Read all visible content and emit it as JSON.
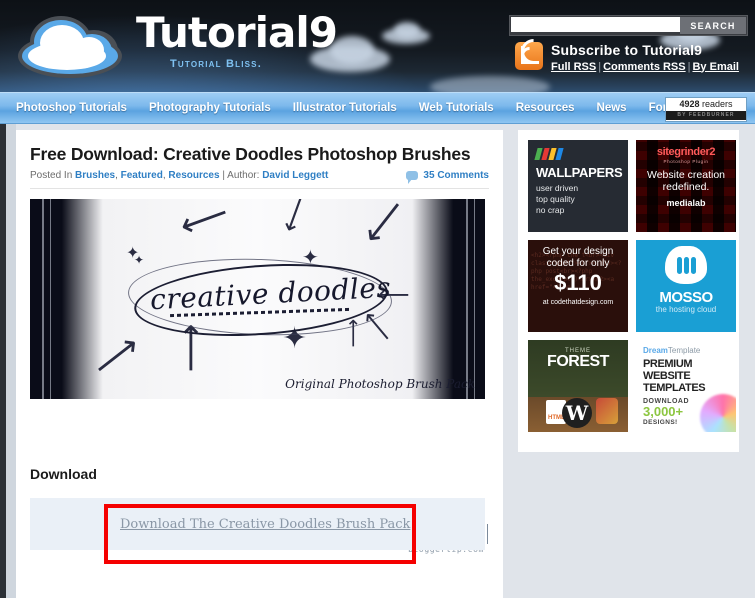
{
  "header": {
    "logo_text": "Tutorial9",
    "logo_tagline": "Tutorial Bliss.",
    "search": {
      "value": "",
      "placeholder": "",
      "button_label": "SEARCH"
    },
    "rss": {
      "title": "Subscribe to Tutorial9",
      "links": [
        "Full RSS",
        "Comments RSS",
        "By Email"
      ],
      "separator": "|"
    }
  },
  "nav": {
    "items": [
      "Photoshop Tutorials",
      "Photography Tutorials",
      "Illustrator Tutorials",
      "Web Tutorials",
      "Resources",
      "News",
      "Forums"
    ],
    "feedburner": {
      "count": "4928",
      "unit": "readers",
      "by": "BY FEEDBURNER"
    }
  },
  "post": {
    "title": "Free Download: Creative Doodles Photoshop Brushes",
    "meta_prefix": "Posted In",
    "categories": [
      "Brushes",
      "Featured",
      "Resources"
    ],
    "author_label": "Author:",
    "author": "David Leggett",
    "comments": "35 Comments",
    "featured_image": {
      "headline": "creative doodles",
      "caption": "Original Photoshop Brush Pack"
    },
    "watermark": "bloggertip.com",
    "download_heading": "Download",
    "download_link": "Download The Creative Doodles Brush Pack"
  },
  "sidebar": {
    "ads": [
      {
        "name": "wallpapers",
        "title": "WALLPAPERS",
        "lines": [
          "user driven",
          "top quality",
          "no crap"
        ]
      },
      {
        "name": "sitegrinder",
        "brand": "sitegrinder2",
        "sub": "Photoshop Plugin",
        "headline": "Website creation redefined.",
        "sponsor": "medialab"
      },
      {
        "name": "codethatdesign",
        "line1": "Get your design",
        "line2": "coded for only",
        "price": "$110",
        "at": "at codethatdesign.com"
      },
      {
        "name": "mosso",
        "brand": "MOSSO",
        "tagline": "the hosting cloud"
      },
      {
        "name": "themeforest",
        "small": "THEME",
        "big": "FOREST",
        "doc_label": "HTML",
        "wp_label": "W"
      },
      {
        "name": "dreamtemplate",
        "brand_a": "Dream",
        "brand_b": "Template",
        "headline": "PREMIUM WEBSITE TEMPLATES",
        "cta1": "DOWNLOAD",
        "cta2": "3,000+",
        "cta3": "DESIGNS!"
      }
    ]
  },
  "annotation": {
    "color": "#f50000",
    "target": "download-link"
  }
}
